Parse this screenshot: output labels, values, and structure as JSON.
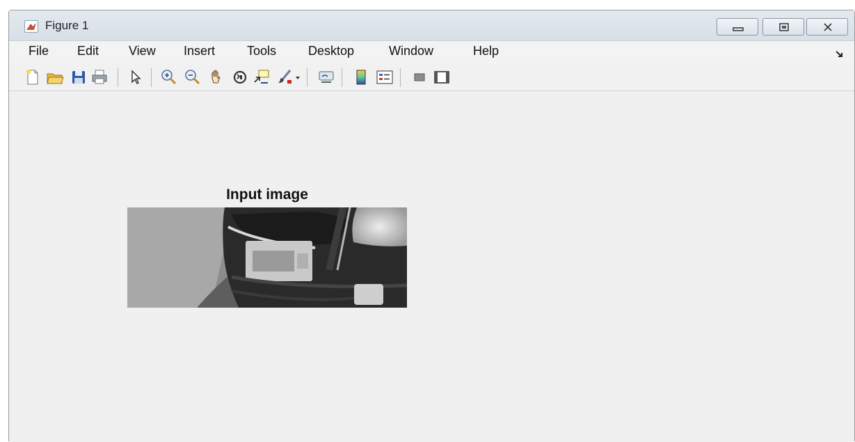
{
  "window": {
    "title": "Figure 1"
  },
  "menubar": {
    "items": [
      "File",
      "Edit",
      "View",
      "Insert",
      "Tools",
      "Desktop",
      "Window",
      "Help"
    ]
  },
  "toolbar": {
    "buttons": [
      "new-figure-icon",
      "open-file-icon",
      "save-icon",
      "print-icon",
      "edit-plot-pointer-icon",
      "zoom-in-icon",
      "zoom-out-icon",
      "pan-hand-icon",
      "rotate-3d-icon",
      "data-cursor-icon",
      "brush-icon",
      "brush-dropdown-icon",
      "link-plot-icon",
      "insert-colorbar-icon",
      "insert-legend-icon",
      "hide-plot-tools-icon",
      "show-plot-tools-icon"
    ]
  },
  "axes": {
    "title": "Input image"
  },
  "colors": {
    "background": "#f0f0f0",
    "titlebar": "#dde3ea"
  }
}
